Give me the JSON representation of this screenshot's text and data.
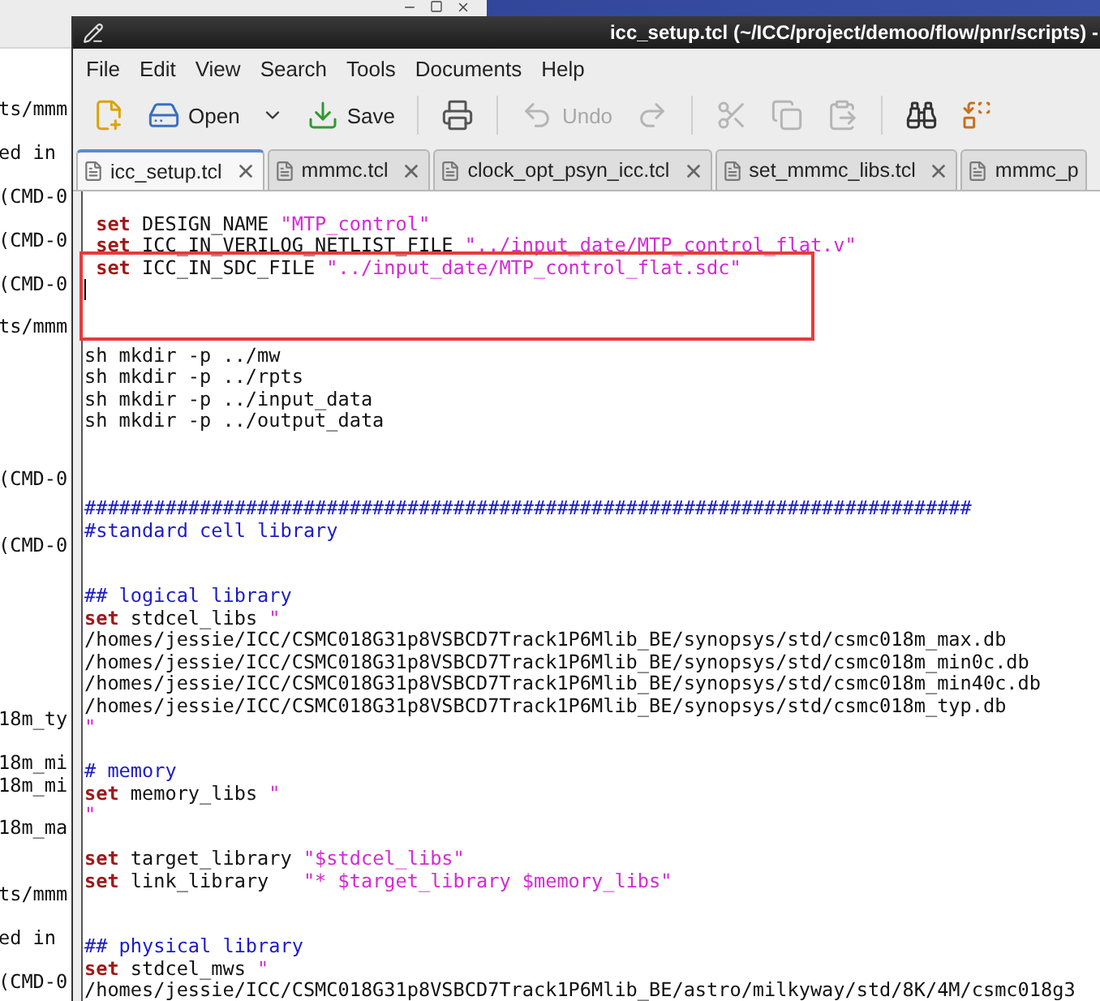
{
  "background_window": {
    "lines": [
      {
        "kind": "text",
        "text": "ts/mmm"
      },
      {
        "kind": "blank"
      },
      {
        "kind": "text",
        "text": "ed in"
      },
      {
        "kind": "blank"
      },
      {
        "kind": "text",
        "text": "(CMD-0"
      },
      {
        "kind": "blank"
      },
      {
        "kind": "text",
        "text": "(CMD-0"
      },
      {
        "kind": "blank"
      },
      {
        "kind": "text",
        "text": "(CMD-0"
      },
      {
        "kind": "blank"
      },
      {
        "kind": "text",
        "text": "ts/mmm"
      },
      {
        "kind": "blank"
      },
      {
        "kind": "blank"
      },
      {
        "kind": "blank"
      },
      {
        "kind": "blank"
      },
      {
        "kind": "blank"
      },
      {
        "kind": "blank"
      },
      {
        "kind": "text",
        "text": "(CMD-0"
      },
      {
        "kind": "blank"
      },
      {
        "kind": "blank"
      },
      {
        "kind": "text",
        "text": "(CMD-0"
      },
      {
        "kind": "blank"
      },
      {
        "kind": "blank"
      },
      {
        "kind": "blank"
      },
      {
        "kind": "blank"
      },
      {
        "kind": "blank"
      },
      {
        "kind": "blank"
      },
      {
        "kind": "blank"
      },
      {
        "kind": "text",
        "text": "18m_ty"
      },
      {
        "kind": "blank"
      },
      {
        "kind": "text",
        "text": "18m_mi"
      },
      {
        "kind": "text",
        "text": "18m_mi"
      },
      {
        "kind": "blank"
      },
      {
        "kind": "text",
        "text": "18m_ma"
      },
      {
        "kind": "blank"
      },
      {
        "kind": "blank"
      },
      {
        "kind": "text",
        "text": "ts/mmm"
      },
      {
        "kind": "blank"
      },
      {
        "kind": "text",
        "text": "ed in"
      },
      {
        "kind": "blank"
      },
      {
        "kind": "text",
        "text": "(CMD-0"
      }
    ]
  },
  "window": {
    "title": "icc_setup.tcl (~/ICC/project/demoo/flow/pnr/scripts) -"
  },
  "menu": [
    "File",
    "Edit",
    "View",
    "Search",
    "Tools",
    "Documents",
    "Help"
  ],
  "toolbar": [
    {
      "kind": "button",
      "disabled": false
    },
    {
      "kind": "button",
      "label": "Open",
      "disabled": false,
      "dropdown": true
    },
    {
      "kind": "button",
      "label": "Save",
      "disabled": false
    },
    {
      "kind": "separator"
    },
    {
      "kind": "button",
      "disabled": false
    },
    {
      "kind": "separator"
    },
    {
      "kind": "button",
      "label": "Undo",
      "disabled": true
    },
    {
      "kind": "button",
      "disabled": true
    },
    {
      "kind": "separator"
    },
    {
      "kind": "button",
      "disabled": true
    },
    {
      "kind": "button",
      "disabled": true
    },
    {
      "kind": "button",
      "disabled": true
    },
    {
      "kind": "separator"
    },
    {
      "kind": "button",
      "disabled": false
    },
    {
      "kind": "button",
      "disabled": false
    }
  ],
  "tabs": [
    {
      "label": "icc_setup.tcl",
      "selected": true,
      "closable": true
    },
    {
      "label": "mmmc.tcl",
      "selected": false,
      "closable": true
    },
    {
      "label": "clock_opt_psyn_icc.tcl",
      "selected": false,
      "closable": true
    },
    {
      "label": "set_mmmc_libs.tcl",
      "selected": false,
      "closable": true
    },
    {
      "label": "mmmc_p",
      "selected": false,
      "closable": false
    }
  ],
  "editor": {
    "annotation": {
      "kind": "rectangle"
    },
    "lines": [
      {
        "kind": "blank"
      },
      {
        "kind": "code",
        "indented": true,
        "segments": [
          {
            "kind": "keyword",
            "text": "set"
          },
          {
            "kind": "plain",
            "text": " DESIGN_NAME "
          },
          {
            "kind": "string",
            "text": "\"MTP_control\""
          }
        ]
      },
      {
        "kind": "code",
        "indented": true,
        "segments": [
          {
            "kind": "keyword",
            "text": "set"
          },
          {
            "kind": "plain",
            "text": " ICC_IN_VERILOG_NETLIST_FILE "
          },
          {
            "kind": "string",
            "text": "\"../input_date/MTP_control_flat.v\""
          }
        ]
      },
      {
        "kind": "code",
        "indented": true,
        "segments": [
          {
            "kind": "keyword",
            "text": "set"
          },
          {
            "kind": "plain",
            "text": " ICC_IN_SDC_FILE "
          },
          {
            "kind": "string",
            "text": "\"../input_date/MTP_control_flat.sdc\""
          }
        ]
      },
      {
        "kind": "cursor"
      },
      {
        "kind": "blank"
      },
      {
        "kind": "blank"
      },
      {
        "kind": "code",
        "segments": [
          {
            "kind": "plain",
            "text": "sh mkdir -p ../mw"
          }
        ]
      },
      {
        "kind": "code",
        "segments": [
          {
            "kind": "plain",
            "text": "sh mkdir -p ../rpts"
          }
        ]
      },
      {
        "kind": "code",
        "segments": [
          {
            "kind": "plain",
            "text": "sh mkdir -p ../input_data"
          }
        ]
      },
      {
        "kind": "code",
        "segments": [
          {
            "kind": "plain",
            "text": "sh mkdir -p ../output_data"
          }
        ]
      },
      {
        "kind": "blank"
      },
      {
        "kind": "blank"
      },
      {
        "kind": "blank"
      },
      {
        "kind": "code",
        "segments": [
          {
            "kind": "comment",
            "text": "#############################################################################"
          }
        ]
      },
      {
        "kind": "code",
        "segments": [
          {
            "kind": "comment",
            "text": "#standard cell library"
          }
        ]
      },
      {
        "kind": "blank"
      },
      {
        "kind": "blank"
      },
      {
        "kind": "code",
        "segments": [
          {
            "kind": "comment",
            "text": "## logical library"
          }
        ]
      },
      {
        "kind": "code",
        "segments": [
          {
            "kind": "keyword",
            "text": "set"
          },
          {
            "kind": "plain",
            "text": " stdcel_libs "
          },
          {
            "kind": "string",
            "text": "\""
          }
        ]
      },
      {
        "kind": "code",
        "segments": [
          {
            "kind": "plain",
            "text": "/homes/jessie/ICC/CSMC018G31p8VSBCD7Track1P6Mlib_BE/synopsys/std/csmc018m_max.db"
          }
        ]
      },
      {
        "kind": "code",
        "segments": [
          {
            "kind": "plain",
            "text": "/homes/jessie/ICC/CSMC018G31p8VSBCD7Track1P6Mlib_BE/synopsys/std/csmc018m_min0c.db"
          }
        ]
      },
      {
        "kind": "code",
        "segments": [
          {
            "kind": "plain",
            "text": "/homes/jessie/ICC/CSMC018G31p8VSBCD7Track1P6Mlib_BE/synopsys/std/csmc018m_min40c.db"
          }
        ]
      },
      {
        "kind": "code",
        "segments": [
          {
            "kind": "plain",
            "text": "/homes/jessie/ICC/CSMC018G31p8VSBCD7Track1P6Mlib_BE/synopsys/std/csmc018m_typ.db"
          }
        ]
      },
      {
        "kind": "code",
        "segments": [
          {
            "kind": "string",
            "text": "\""
          }
        ]
      },
      {
        "kind": "blank"
      },
      {
        "kind": "code",
        "segments": [
          {
            "kind": "comment",
            "text": "# memory"
          }
        ]
      },
      {
        "kind": "code",
        "segments": [
          {
            "kind": "keyword",
            "text": "set"
          },
          {
            "kind": "plain",
            "text": " memory_libs "
          },
          {
            "kind": "string",
            "text": "\""
          }
        ]
      },
      {
        "kind": "code",
        "segments": [
          {
            "kind": "string",
            "text": "\""
          }
        ]
      },
      {
        "kind": "blank"
      },
      {
        "kind": "code",
        "segments": [
          {
            "kind": "keyword",
            "text": "set"
          },
          {
            "kind": "plain",
            "text": " target_library "
          },
          {
            "kind": "string",
            "text": "\"$stdcel_libs\""
          }
        ]
      },
      {
        "kind": "code",
        "segments": [
          {
            "kind": "keyword",
            "text": "set"
          },
          {
            "kind": "plain",
            "text": " link_library   "
          },
          {
            "kind": "string",
            "text": "\"* $target_library $memory_libs\""
          }
        ]
      },
      {
        "kind": "blank"
      },
      {
        "kind": "blank"
      },
      {
        "kind": "code",
        "segments": [
          {
            "kind": "comment",
            "text": "## physical library"
          }
        ]
      },
      {
        "kind": "code",
        "segments": [
          {
            "kind": "keyword",
            "text": "set"
          },
          {
            "kind": "plain",
            "text": " stdcel_mws "
          },
          {
            "kind": "string",
            "text": "\""
          }
        ]
      },
      {
        "kind": "code",
        "segments": [
          {
            "kind": "plain",
            "text": "/homes/jessie/ICC/CSMC018G31p8VSBCD7Track1P6Mlib_BE/astro/milkyway/std/8K/4M/csmc018g3"
          }
        ]
      }
    ]
  }
}
